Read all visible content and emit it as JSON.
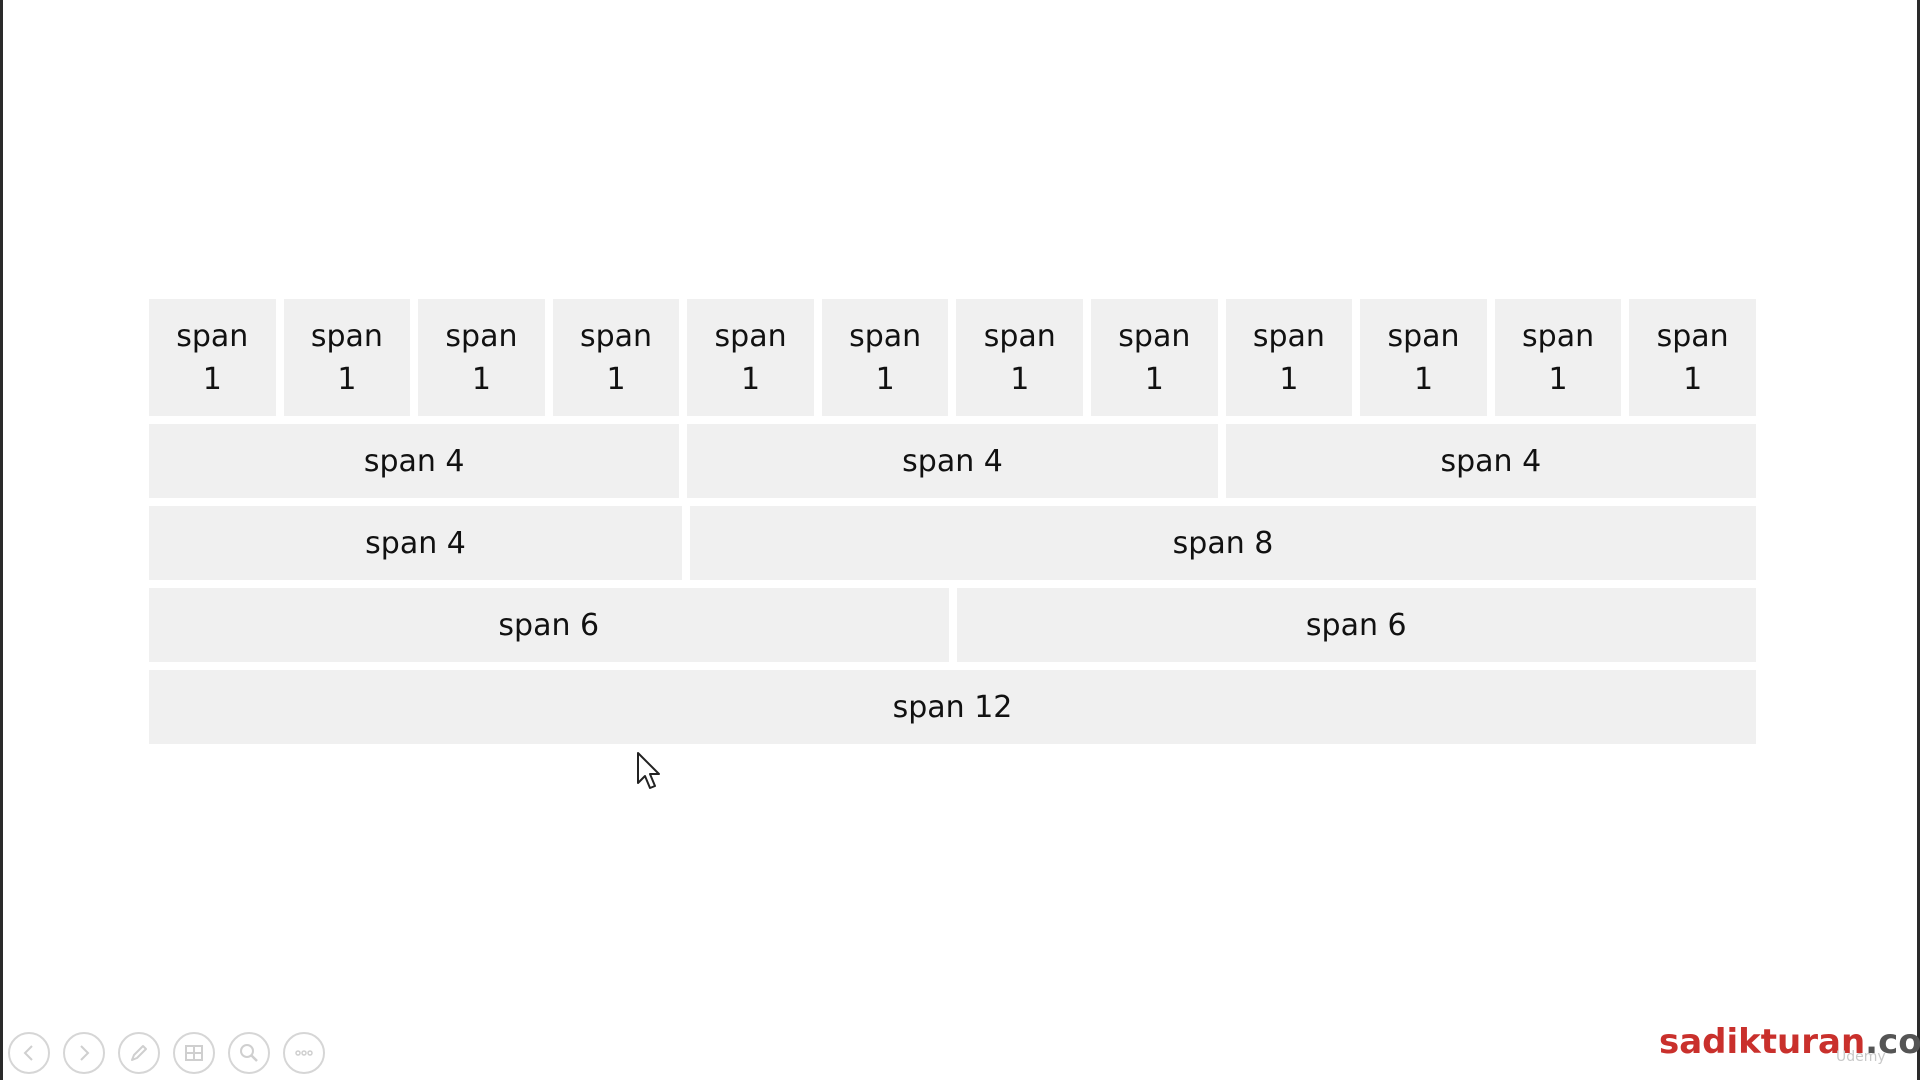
{
  "grid": {
    "row_ones": [
      "span\n1",
      "span\n1",
      "span\n1",
      "span\n1",
      "span\n1",
      "span\n1",
      "span\n1",
      "span\n1",
      "span\n1",
      "span\n1",
      "span\n1",
      "span\n1"
    ],
    "row_fours": [
      "span 4",
      "span 4",
      "span 4"
    ],
    "row_four_eight": [
      "span 4",
      "span 8"
    ],
    "row_sixes": [
      "span 6",
      "span 6"
    ],
    "row_twelve": [
      "span 12"
    ]
  },
  "controls": {
    "icons": [
      "previous-icon",
      "next-icon",
      "pen-icon",
      "slides-icon",
      "zoom-icon",
      "more-icon"
    ]
  },
  "brand": {
    "name": "sadikturan",
    "tld": ".com",
    "watermark": "Udemy"
  },
  "colors": {
    "cell_bg": "#f0f0f0",
    "brand_red": "#c9302c",
    "brand_gray": "#555555"
  }
}
